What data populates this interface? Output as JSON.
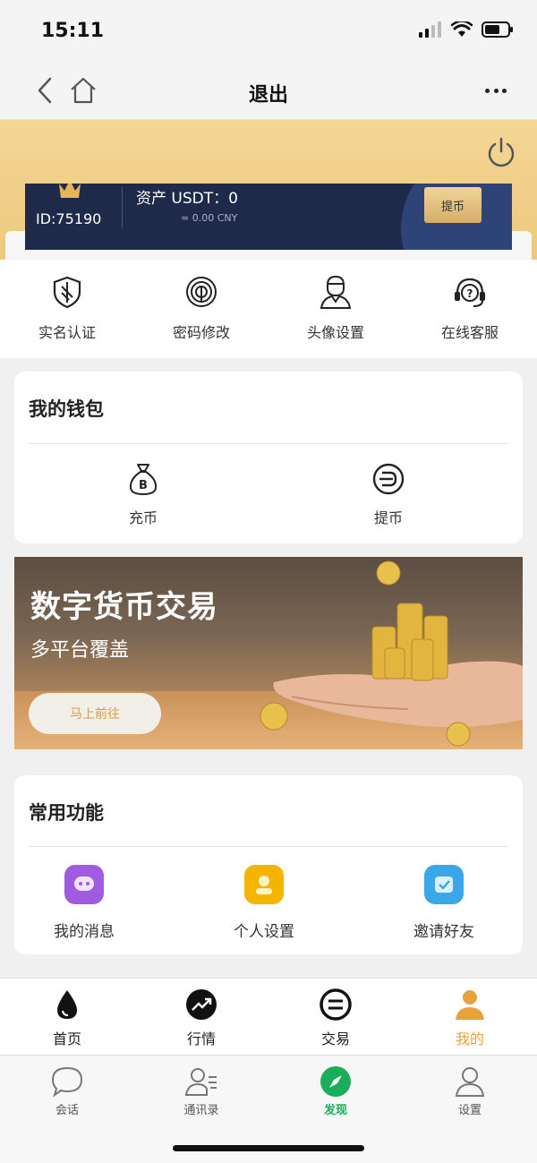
{
  "status_bar": {
    "time": "15:11"
  },
  "nav": {
    "title": "退出"
  },
  "account": {
    "user_id": "ID:75190",
    "asset_label": "资产 USDT：0",
    "asset_cny": "≈ 0.00 CNY",
    "withdraw_label": "提币"
  },
  "quick_actions": [
    {
      "label": "实名认证",
      "icon": "shield-icon"
    },
    {
      "label": "密码修改",
      "icon": "fingerprint-icon"
    },
    {
      "label": "头像设置",
      "icon": "person-icon"
    },
    {
      "label": "在线客服",
      "icon": "headset-icon"
    }
  ],
  "wallet": {
    "title": "我的钱包",
    "items": [
      {
        "label": "充币",
        "icon": "money-bag-icon"
      },
      {
        "label": "提币",
        "icon": "coin-withdraw-icon"
      }
    ]
  },
  "banner": {
    "title": "数字货币交易",
    "subtitle": "多平台覆盖",
    "button_label": "马上前往"
  },
  "features": {
    "title": "常用功能",
    "items": [
      {
        "label": "我的消息",
        "icon": "message-icon",
        "color": "#a05be0"
      },
      {
        "label": "个人设置",
        "icon": "profile-icon",
        "color": "#f4b400"
      },
      {
        "label": "邀请好友",
        "icon": "invite-icon",
        "color": "#3aa8e8"
      }
    ]
  },
  "app_tabs": [
    {
      "label": "首页",
      "icon": "drop-icon"
    },
    {
      "label": "行情",
      "icon": "trend-icon"
    },
    {
      "label": "交易",
      "icon": "exchange-icon"
    },
    {
      "label": "我的",
      "icon": "user-icon",
      "active": true
    }
  ],
  "wx_tabs": [
    {
      "label": "会话",
      "icon": "chat-icon"
    },
    {
      "label": "通讯录",
      "icon": "contacts-icon"
    },
    {
      "label": "发现",
      "icon": "compass-icon",
      "active": true
    },
    {
      "label": "设置",
      "icon": "settings-person-icon"
    }
  ],
  "colors": {
    "accent": "#e8a23c",
    "hero": "#f4d695",
    "card_dark": "#1f2a4a",
    "wx_active": "#1aad5a"
  }
}
